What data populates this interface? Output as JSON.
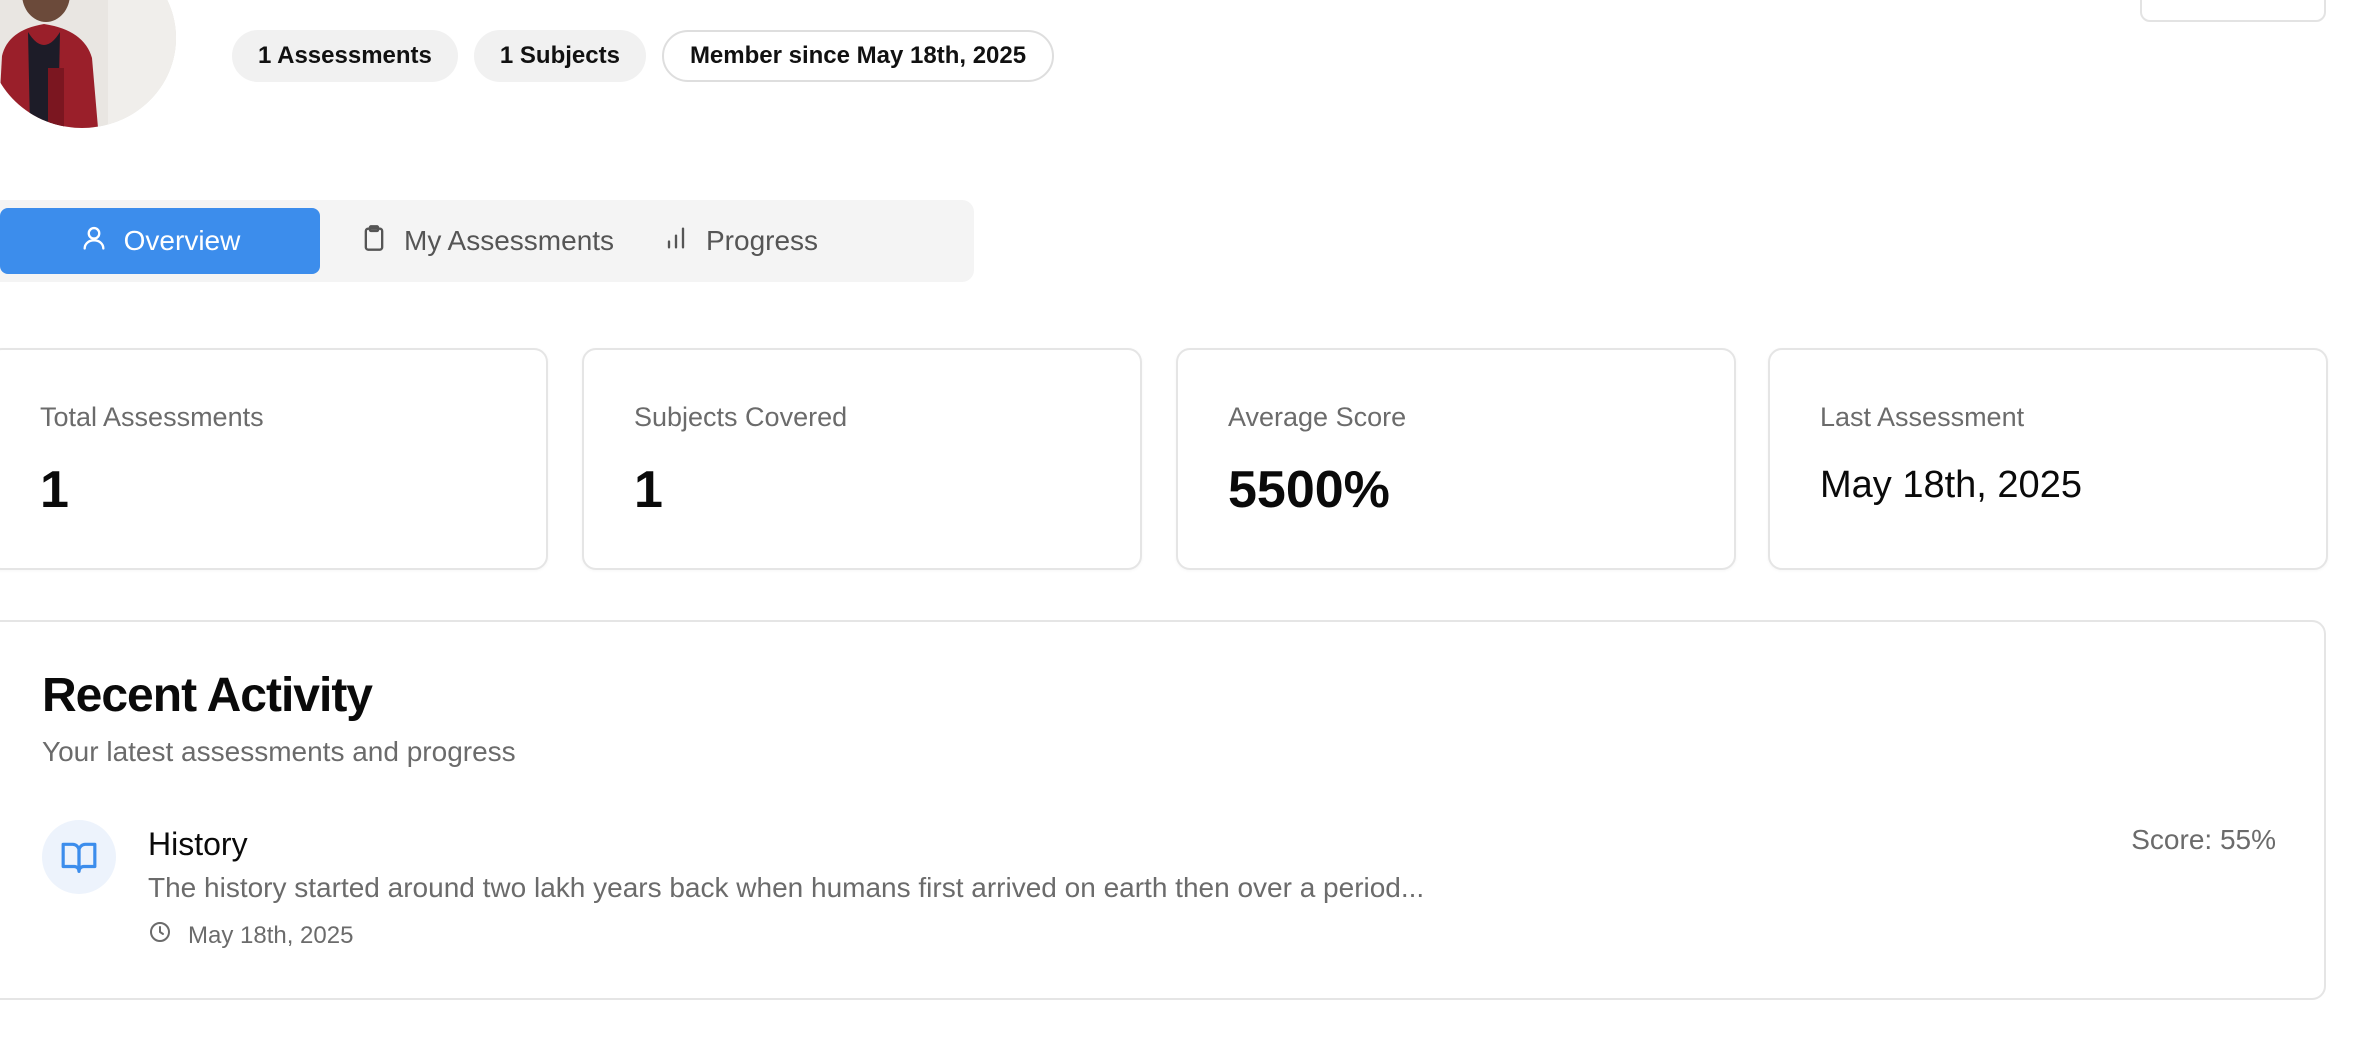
{
  "profile": {
    "badges": [
      {
        "label": "1 Assessments"
      },
      {
        "label": "1 Subjects"
      },
      {
        "label": "Member since May 18th, 2025"
      }
    ]
  },
  "tabs": [
    {
      "label": "Overview",
      "icon": "user-icon",
      "active": true
    },
    {
      "label": "My Assessments",
      "icon": "clipboard-icon",
      "active": false
    },
    {
      "label": "Progress",
      "icon": "bar-chart-icon",
      "active": false
    }
  ],
  "stats": [
    {
      "label": "Total Assessments",
      "value": "1"
    },
    {
      "label": "Subjects Covered",
      "value": "1"
    },
    {
      "label": "Average Score",
      "value": "5500%"
    },
    {
      "label": "Last Assessment",
      "value": "May 18th, 2025"
    }
  ],
  "recent_activity": {
    "title": "Recent Activity",
    "subtitle": "Your latest assessments and progress",
    "items": [
      {
        "icon": "book-open-icon",
        "subject": "History",
        "description": "The history started around two lakh years back when humans first arrived on earth then over a period...",
        "date": "May 18th, 2025",
        "date_icon": "clock-icon",
        "score": "Score: 55%"
      }
    ]
  },
  "colors": {
    "accent": "#3c8dec",
    "muted_text": "#6b6b6b",
    "border": "#e5e5e5",
    "tab_bg": "#f4f4f4"
  }
}
